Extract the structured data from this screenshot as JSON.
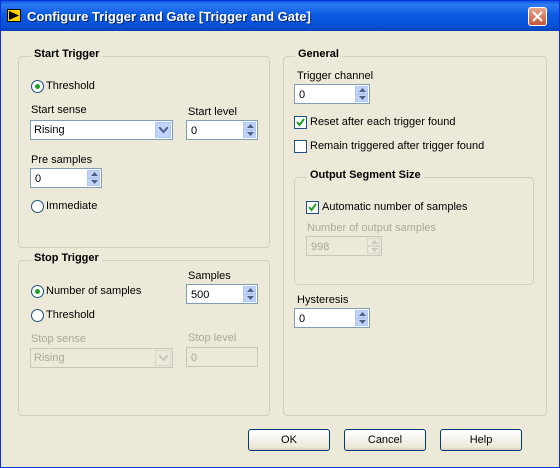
{
  "window": {
    "title": "Configure Trigger and Gate [Trigger and Gate]"
  },
  "start_trigger": {
    "title": "Start Trigger",
    "threshold_label": "Threshold",
    "start_sense_label": "Start sense",
    "start_sense_value": "Rising",
    "start_level_label": "Start level",
    "start_level_value": "0",
    "pre_samples_label": "Pre samples",
    "pre_samples_value": "0",
    "immediate_label": "Immediate",
    "selected": "threshold"
  },
  "stop_trigger": {
    "title": "Stop Trigger",
    "number_of_samples_label": "Number of samples",
    "threshold_label": "Threshold",
    "samples_label": "Samples",
    "samples_value": "500",
    "stop_sense_label": "Stop sense",
    "stop_sense_value": "Rising",
    "stop_level_label": "Stop level",
    "stop_level_value": "0",
    "selected": "number_of_samples"
  },
  "general": {
    "title": "General",
    "trigger_channel_label": "Trigger channel",
    "trigger_channel_value": "0",
    "reset_label": "Reset after each trigger found",
    "reset_checked": true,
    "remain_label": "Remain triggered after trigger found",
    "remain_checked": false,
    "output_segment": {
      "title": "Output Segment Size",
      "automatic_label": "Automatic number of samples",
      "automatic_checked": true,
      "number_output_label": "Number of output samples",
      "number_output_value": "998"
    },
    "hysteresis_label": "Hysteresis",
    "hysteresis_value": "0"
  },
  "buttons": {
    "ok": "OK",
    "cancel": "Cancel",
    "help": "Help"
  },
  "colors": {
    "titlebar": "#0a5be3",
    "dialog_bg": "#ece9d8",
    "radio_dot": "#21a121",
    "disabled_text": "#aca899"
  }
}
